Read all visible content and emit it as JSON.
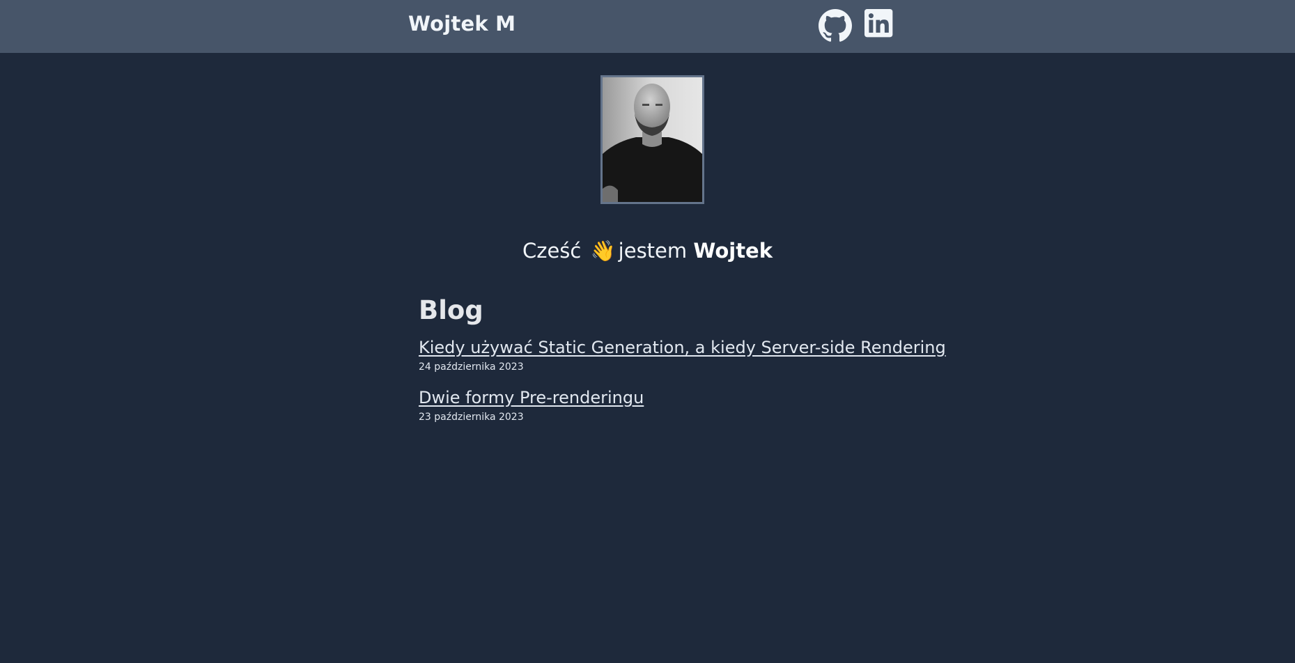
{
  "header": {
    "brand": "Wojtek M",
    "links": [
      {
        "icon": "github-icon"
      },
      {
        "icon": "linkedin-icon"
      }
    ]
  },
  "profile": {
    "image_icon": "portrait-photo",
    "greeting_prefix": "Cześć",
    "wave": "👋",
    "greeting_middle": "jestem",
    "name": "Wojtek"
  },
  "blog": {
    "title": "Blog",
    "posts": [
      {
        "title": "Kiedy używać Static Generation, a kiedy Server-side Rendering",
        "date": "24 października 2023"
      },
      {
        "title": "Dwie formy Pre-renderingu",
        "date": "23 października 2023"
      }
    ]
  },
  "colors": {
    "background": "#1e293b",
    "header": "#475569",
    "portrait_border": "#64748b",
    "text": "#e5e7eb"
  }
}
